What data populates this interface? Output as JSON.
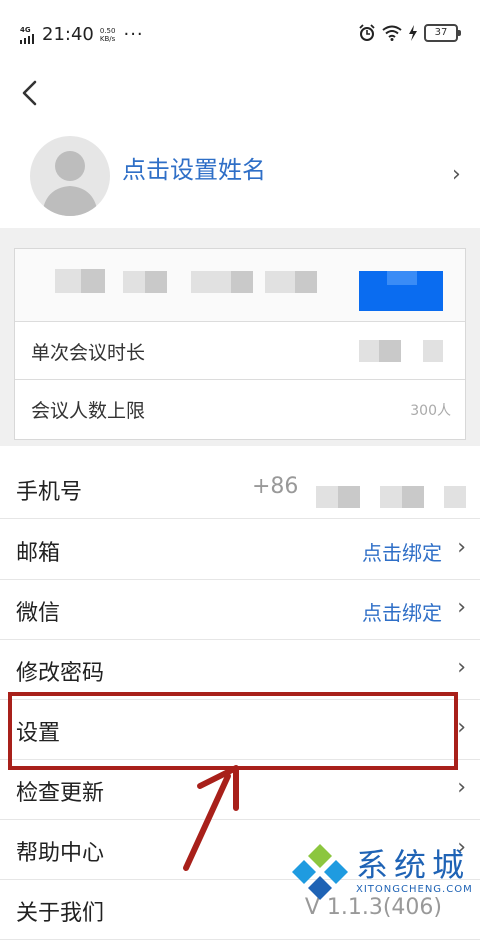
{
  "status_bar": {
    "network": "4G",
    "time": "21:40",
    "net_speed": "0.50",
    "net_unit": "KB/s",
    "more": "···",
    "battery": "37"
  },
  "header": {
    "back_icon": "chevron-left-icon"
  },
  "profile": {
    "name_prompt": "点击设置姓名",
    "avatar_icon": "default-avatar-icon"
  },
  "plan_card": {
    "rows": [
      {
        "label": "单次会议时长",
        "value": ""
      },
      {
        "label": "会议人数上限",
        "value": "300人"
      }
    ]
  },
  "menu": {
    "phone": {
      "label": "手机号",
      "value": "+86"
    },
    "email": {
      "label": "邮箱",
      "action": "点击绑定"
    },
    "wechat": {
      "label": "微信",
      "action": "点击绑定"
    },
    "password": {
      "label": "修改密码"
    },
    "settings": {
      "label": "设置"
    },
    "update": {
      "label": "检查更新"
    },
    "help": {
      "label": "帮助中心"
    },
    "about": {
      "label": "关于我们",
      "value": "V 1.1.3(406)"
    }
  },
  "annotation": {
    "highlight_color": "#a8201a",
    "arrow_color": "#a8201a"
  },
  "watermark": {
    "text": "系统城",
    "url": "XITONGCHENG.COM"
  }
}
